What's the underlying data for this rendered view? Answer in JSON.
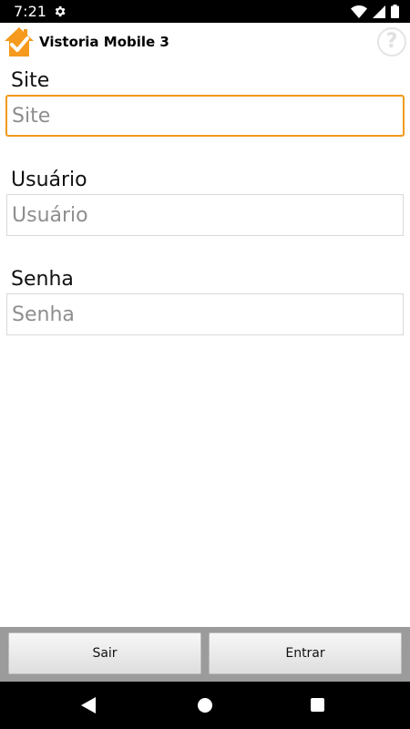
{
  "status_bar": {
    "time": "7:21",
    "icons": [
      "settings-icon",
      "wifi-icon",
      "signal-icon",
      "battery-icon"
    ]
  },
  "app_header": {
    "title": "Vistoria Mobile 3",
    "logo": "house-check-icon",
    "help_symbol": "?",
    "accent_color": "#f59a1c"
  },
  "form": {
    "site": {
      "label": "Site",
      "placeholder": "Site",
      "value": ""
    },
    "user": {
      "label": "Usuário",
      "placeholder": "Usuário",
      "value": ""
    },
    "password": {
      "label": "Senha",
      "placeholder": "Senha",
      "value": ""
    },
    "focus_color": "#f09a1a"
  },
  "actions": {
    "exit_label": "Sair",
    "enter_label": "Entrar"
  },
  "nav_bar": {
    "icons": [
      "back-icon",
      "home-icon",
      "recents-icon"
    ]
  }
}
